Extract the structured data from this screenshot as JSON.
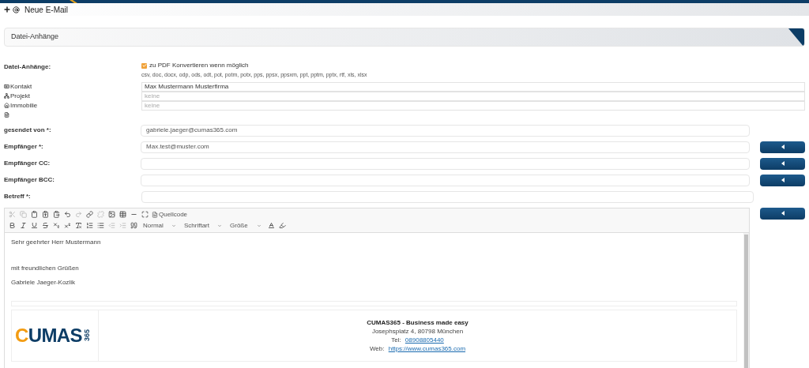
{
  "header": {
    "title": "Neue E-Mail"
  },
  "section": {
    "title": "Datei-Anhänge"
  },
  "attachments": {
    "label": "Datei-Anhänge:",
    "convert_label": "zu PDF Konvertieren wenn möglich",
    "checked": true,
    "formats": "csv, doc, docx, odp, ods, odt, pot, potm, potx, pps, ppsx, ppsxm, ppt, pptm, pptx, rtf, xls, xlsx"
  },
  "links": [
    {
      "kind": "contact",
      "label": "Kontakt",
      "value": "Max Mustermann Musterfirma"
    },
    {
      "kind": "project",
      "label": "Projekt",
      "placeholder": "keine"
    },
    {
      "kind": "property",
      "label": "Immobilie",
      "placeholder": "keine"
    },
    {
      "kind": "document"
    }
  ],
  "fields": [
    {
      "label": "gesendet von *:",
      "value": "gabriele.jaeger@cumas365.com",
      "picker": false
    },
    {
      "label": "Empfänger *:",
      "value": "Max.test@muster.com",
      "picker": true
    },
    {
      "label": "Empfänger CC:",
      "picker": true
    },
    {
      "label": "Empfänger BCC:",
      "picker": true
    },
    {
      "label": "Betreff *:",
      "picker": false
    }
  ],
  "editor": {
    "picker": true,
    "source_label": "Quellcode",
    "format": "Normal",
    "font": "Schriftart",
    "size": "Größe",
    "greeting": "Sehr geehrter Herr Mustermann",
    "closing": "mit freundlichen Grüßen",
    "name": "Gabriele Jaeger-Kozlik",
    "signature": {
      "logo_word": "CUMAS",
      "logo_number": "365",
      "lines": [
        {
          "kind": "title",
          "text": "CUMAS365 - Business made easy"
        },
        {
          "kind": "plain",
          "text": "Josephsplatz 4,  80798 München"
        },
        {
          "kind": "link",
          "text": "Tel: ",
          "link": "08908805440"
        },
        {
          "kind": "link",
          "text": "Web: ",
          "link": "https://www.cumas365.com"
        }
      ]
    }
  }
}
